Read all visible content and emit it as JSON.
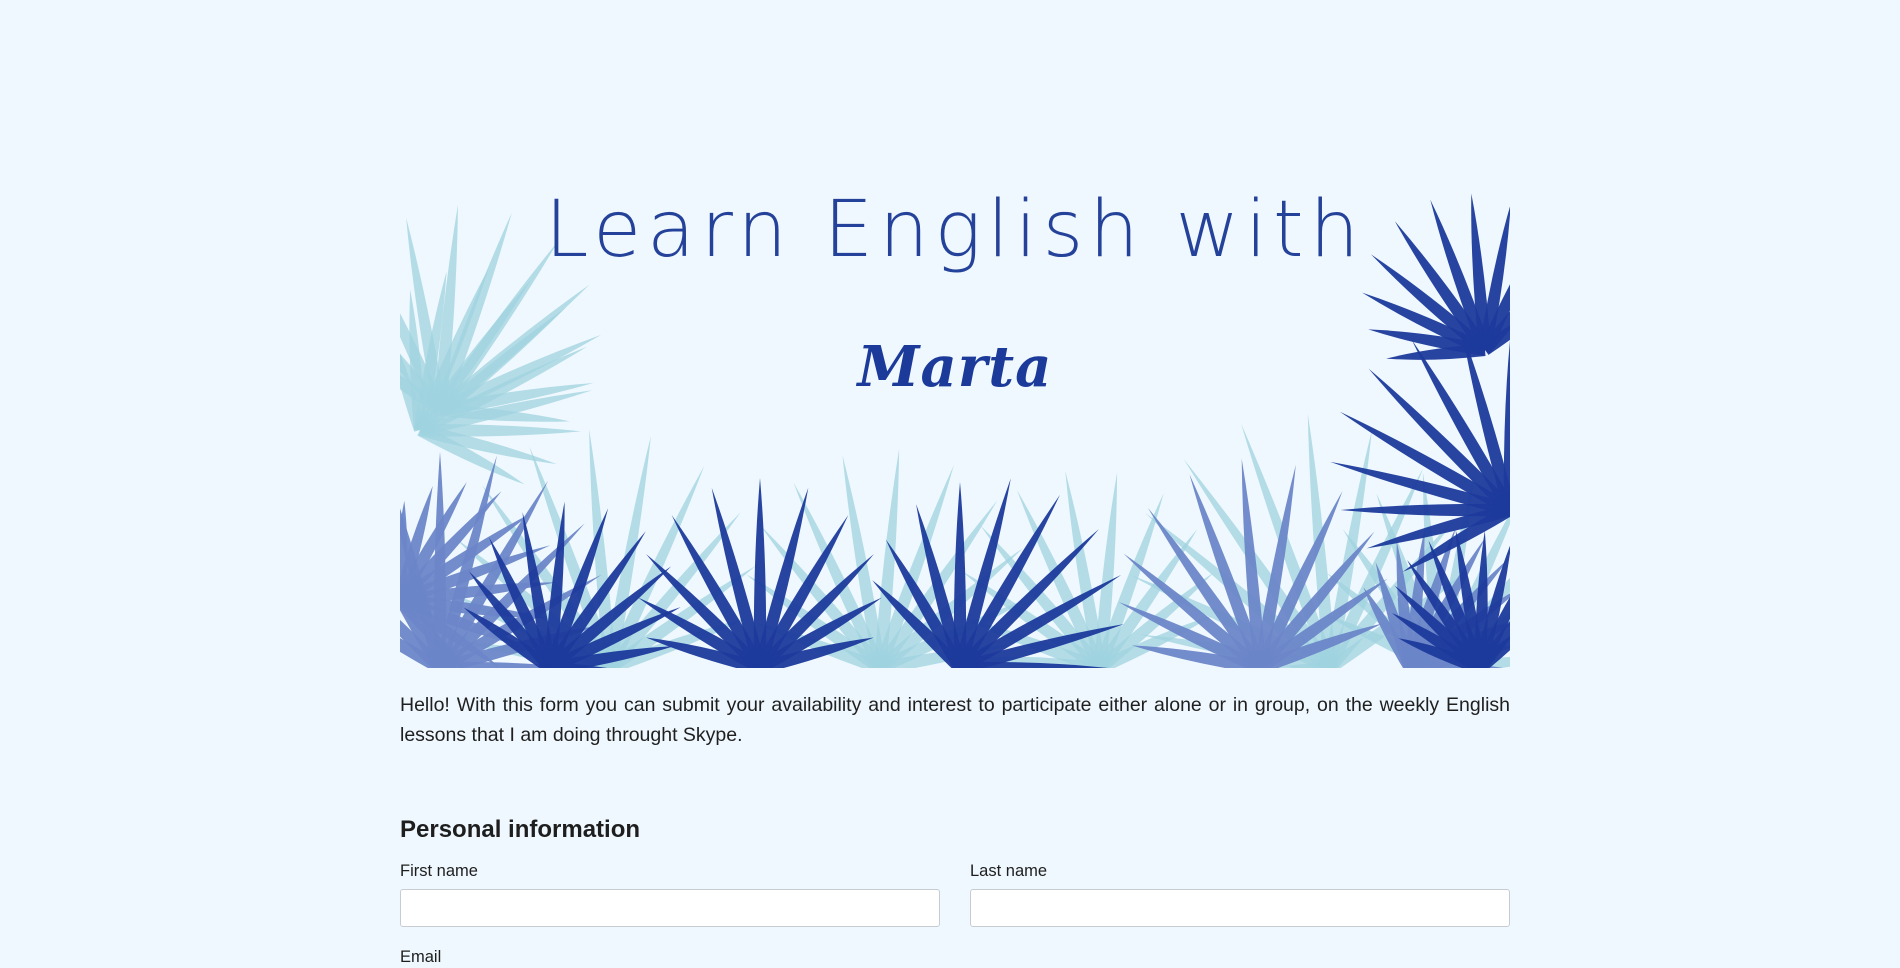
{
  "hero": {
    "title": "Learn English with",
    "name": "Marta"
  },
  "intro": "Hello! With this form you can submit your availability and interest to participate either alone or in group, on the weekly English lessons that I am doing throught Skype.",
  "form": {
    "section_title": "Personal information",
    "first_name_label": "First name",
    "first_name_value": "",
    "last_name_label": "Last name",
    "last_name_value": "",
    "email_label": "Email"
  },
  "colors": {
    "background": "#eff8fe",
    "title_blue": "#25429a",
    "leaf_dark": "#1c3a9c",
    "leaf_mid": "#6b86c8",
    "leaf_light": "#9fd3df"
  }
}
